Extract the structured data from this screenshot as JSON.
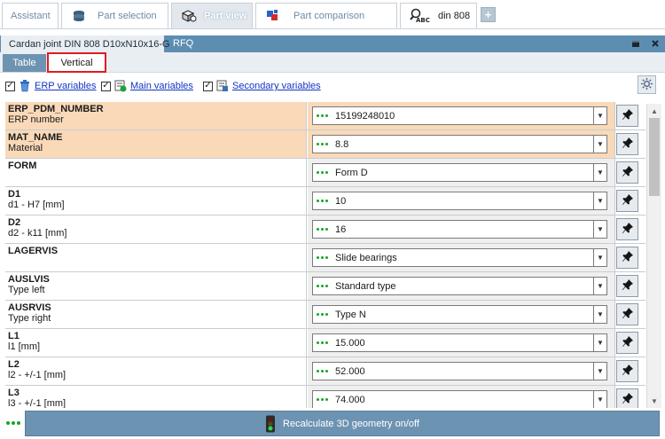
{
  "top_tabs": [
    {
      "label": "Assistant",
      "icon": "none"
    },
    {
      "label": "Part selection",
      "icon": "stack-icon"
    },
    {
      "label": "Part view",
      "icon": "parts-icon",
      "active": true
    },
    {
      "label": "Part comparison",
      "icon": "compare-icon"
    },
    {
      "label": "din 808",
      "icon": "search-abc-icon"
    }
  ],
  "plus_label": "+",
  "part_header": {
    "title": "Cardan joint DIN 808 D10xN10x16-G",
    "rfq": "RFQ"
  },
  "sub_tabs": {
    "table": "Table",
    "vertical": "Vertical"
  },
  "checks": {
    "erp": {
      "label": "ERP variables",
      "checked": "✓"
    },
    "main": {
      "label": "Main variables",
      "checked": "✓"
    },
    "secondary": {
      "label": "Secondary variables",
      "checked": "✓"
    }
  },
  "rows": [
    {
      "name": "ERP_PDM_NUMBER",
      "desc": "ERP number",
      "value": "15199248010",
      "erp": true
    },
    {
      "name": "MAT_NAME",
      "desc": "Material",
      "value": "8.8",
      "erp": true
    },
    {
      "name": "FORM",
      "desc": "",
      "value": "Form D",
      "erp": false
    },
    {
      "name": "D1",
      "desc": "d1 - H7 [mm]",
      "value": "10",
      "erp": false
    },
    {
      "name": "D2",
      "desc": "d2 - k11 [mm]",
      "value": "16",
      "erp": false
    },
    {
      "name": "LAGERVIS",
      "desc": "",
      "value": "Slide bearings",
      "erp": false
    },
    {
      "name": "AUSLVIS",
      "desc": "Type left",
      "value": "Standard type",
      "erp": false
    },
    {
      "name": "AUSRVIS",
      "desc": "Type right",
      "value": "Type N",
      "erp": false
    },
    {
      "name": "L1",
      "desc": "l1 [mm]",
      "value": "15.000",
      "erp": false
    },
    {
      "name": "L2",
      "desc": "l2 - +/-1 [mm]",
      "value": "52.000",
      "erp": false
    },
    {
      "name": "L3",
      "desc": "l3 - +/-1 [mm]",
      "value": "74.000",
      "erp": false
    }
  ],
  "bottom": {
    "recalc_label": "Recalculate 3D geometry on/off"
  },
  "colors": {
    "erp_row": "#f9d9b8",
    "accent": "#5d8eb2",
    "dots": "#0fa821"
  }
}
